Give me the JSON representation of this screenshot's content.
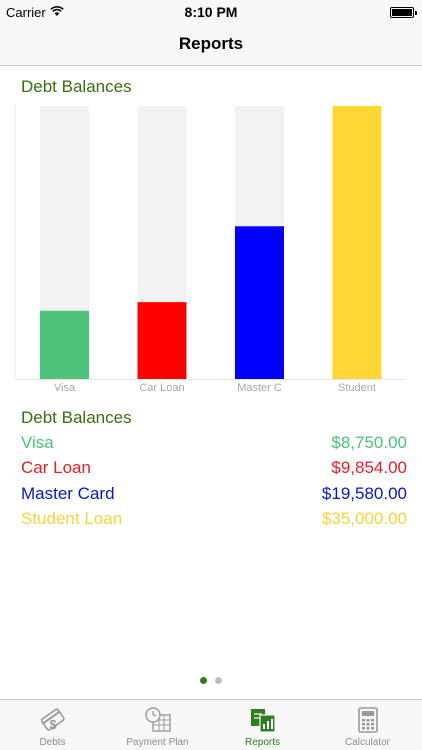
{
  "status_bar": {
    "carrier": "Carrier",
    "time": "8:10 PM"
  },
  "nav": {
    "title": "Reports"
  },
  "chart_title": "Debt Balances",
  "chart_data": {
    "type": "bar",
    "title": "Debt Balances",
    "categories": [
      "Visa",
      "Car Loan",
      "Master C",
      "Student"
    ],
    "values": [
      8750,
      9854,
      19580,
      35000
    ],
    "colors": [
      "#4cc27a",
      "#ff0000",
      "#0000ff",
      "#ffd633"
    ],
    "track_color": "#f2f2f2",
    "ylim": [
      0,
      35000
    ],
    "grid": false,
    "legend": "none"
  },
  "list": {
    "title": "Debt Balances",
    "items": [
      {
        "name": "Visa",
        "amount": "$8,750.00",
        "color": "#4cc27a"
      },
      {
        "name": "Car Loan",
        "amount": "$9,854.00",
        "color": "#ea1c24"
      },
      {
        "name": "Master Card",
        "amount": "$19,580.00",
        "color": "#0a17c9"
      },
      {
        "name": "Student Loan",
        "amount": "$35,000.00",
        "color": "#f5d33a"
      }
    ]
  },
  "pager": {
    "current": 1,
    "total": 2
  },
  "tabbar": {
    "tabs": [
      {
        "label": "Debts",
        "icon": "debts-icon",
        "active": false
      },
      {
        "label": "Payment Plan",
        "icon": "payment-plan-icon",
        "active": false
      },
      {
        "label": "Reports",
        "icon": "reports-icon",
        "active": true
      },
      {
        "label": "Calculator",
        "icon": "calculator-icon",
        "active": false
      }
    ]
  }
}
